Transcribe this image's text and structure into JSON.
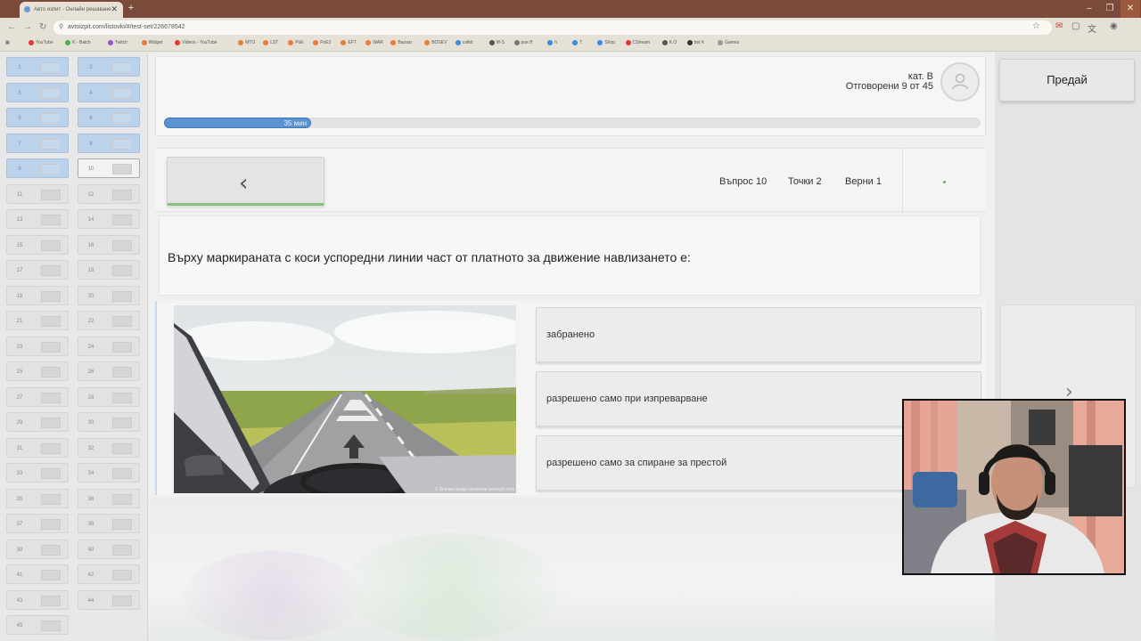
{
  "browser": {
    "tab_title": "Авто изпит - Онлайн решаване",
    "new_tab_symbol": "+",
    "close_symbol": "✕",
    "url": "avtoizpit.com/listovki/#/test-set/226678542",
    "window_controls": {
      "minimize": "–",
      "restore": "❐",
      "close": "✕"
    },
    "bookmarks": [
      {
        "label": "YouTube",
        "color": "#e03b2e"
      },
      {
        "label": "K - Batch",
        "color": "#44b244"
      },
      {
        "label": "Twitch",
        "color": "#8a5ad0"
      },
      {
        "label": "Widget",
        "color": "#e0803b"
      },
      {
        "label": "Videos - YouTube",
        "color": "#e03b2e"
      },
      {
        "label": "MTO",
        "color": "#e0803b"
      },
      {
        "label": "LST",
        "color": "#e0803b"
      },
      {
        "label": "PoE",
        "color": "#e0803b"
      },
      {
        "label": "PoE2",
        "color": "#e0803b"
      },
      {
        "label": "EFT",
        "color": "#e0803b"
      },
      {
        "label": "WAR",
        "color": "#e0803b"
      },
      {
        "label": "Bazaar",
        "color": "#e0803b"
      },
      {
        "label": "BOSEV",
        "color": "#e0803b"
      },
      {
        "label": "catkit",
        "color": "#3b8ae0"
      },
      {
        "label": "W-S",
        "color": "#555555"
      },
      {
        "label": "poe.ff",
        "color": "#777777"
      },
      {
        "label": "h",
        "color": "#3b8ae0"
      },
      {
        "label": "T",
        "color": "#3b8ae0"
      },
      {
        "label": "Shop",
        "color": "#3b8ae0"
      },
      {
        "label": "CStream",
        "color": "#e03b2e"
      },
      {
        "label": "K.O",
        "color": "#555555"
      },
      {
        "label": "bot K",
        "color": "#333333"
      },
      {
        "label": "Games",
        "color": "#999999"
      }
    ]
  },
  "nav": {
    "questions": [
      {
        "num": "1",
        "state": "answered"
      },
      {
        "num": "2",
        "state": "answered"
      },
      {
        "num": "3",
        "state": "answered"
      },
      {
        "num": "4",
        "state": "answered"
      },
      {
        "num": "5",
        "state": "answered"
      },
      {
        "num": "6",
        "state": "answered"
      },
      {
        "num": "7",
        "state": "answered"
      },
      {
        "num": "8",
        "state": "answered"
      },
      {
        "num": "9",
        "state": "answered"
      },
      {
        "num": "10",
        "state": "current"
      },
      {
        "num": "11",
        "state": "open"
      },
      {
        "num": "12",
        "state": "open"
      },
      {
        "num": "13",
        "state": "open"
      },
      {
        "num": "14",
        "state": "open"
      },
      {
        "num": "15",
        "state": "open"
      },
      {
        "num": "16",
        "state": "open"
      },
      {
        "num": "17",
        "state": "open"
      },
      {
        "num": "18",
        "state": "open"
      },
      {
        "num": "19",
        "state": "open"
      },
      {
        "num": "20",
        "state": "open"
      },
      {
        "num": "21",
        "state": "open"
      },
      {
        "num": "22",
        "state": "open"
      },
      {
        "num": "23",
        "state": "open"
      },
      {
        "num": "24",
        "state": "open"
      },
      {
        "num": "25",
        "state": "open"
      },
      {
        "num": "26",
        "state": "open"
      },
      {
        "num": "27",
        "state": "open"
      },
      {
        "num": "28",
        "state": "open"
      },
      {
        "num": "29",
        "state": "open"
      },
      {
        "num": "30",
        "state": "open"
      },
      {
        "num": "31",
        "state": "open"
      },
      {
        "num": "32",
        "state": "open"
      },
      {
        "num": "33",
        "state": "open"
      },
      {
        "num": "34",
        "state": "open"
      },
      {
        "num": "35",
        "state": "open"
      },
      {
        "num": "36",
        "state": "open"
      },
      {
        "num": "37",
        "state": "open"
      },
      {
        "num": "38",
        "state": "open"
      },
      {
        "num": "39",
        "state": "open"
      },
      {
        "num": "40",
        "state": "open"
      },
      {
        "num": "41",
        "state": "open"
      },
      {
        "num": "42",
        "state": "open"
      },
      {
        "num": "43",
        "state": "open"
      },
      {
        "num": "44",
        "state": "open"
      },
      {
        "num": "45",
        "state": "open"
      }
    ]
  },
  "header": {
    "category": "кат. В",
    "answered_text": "Отговорени 9 от  45",
    "timer_text": "35 мин",
    "timer_remaining_fraction": 0.18
  },
  "question_bar": {
    "back_symbol": "‹",
    "question_label": "Въпрос 10",
    "points_label": "Точки 2",
    "correct_label": "Верни 1"
  },
  "question": {
    "text": "Върху маркираната с коси успоредни линии част от платното за движение навлизането е:",
    "image_caption": "© Всички права запазени avtoizpit.com",
    "answers": [
      "забранено",
      "разрешено само при изпреварване",
      "разрешено само за спиране за престой"
    ]
  },
  "actions": {
    "submit_label": "Предай",
    "next_symbol": "›"
  },
  "colors": {
    "accent_blue": "#5b93d2",
    "answered_tile": "#bcd2ea",
    "back_button_underline": "#86c47e",
    "chrome_brown": "#7a4a3a"
  }
}
